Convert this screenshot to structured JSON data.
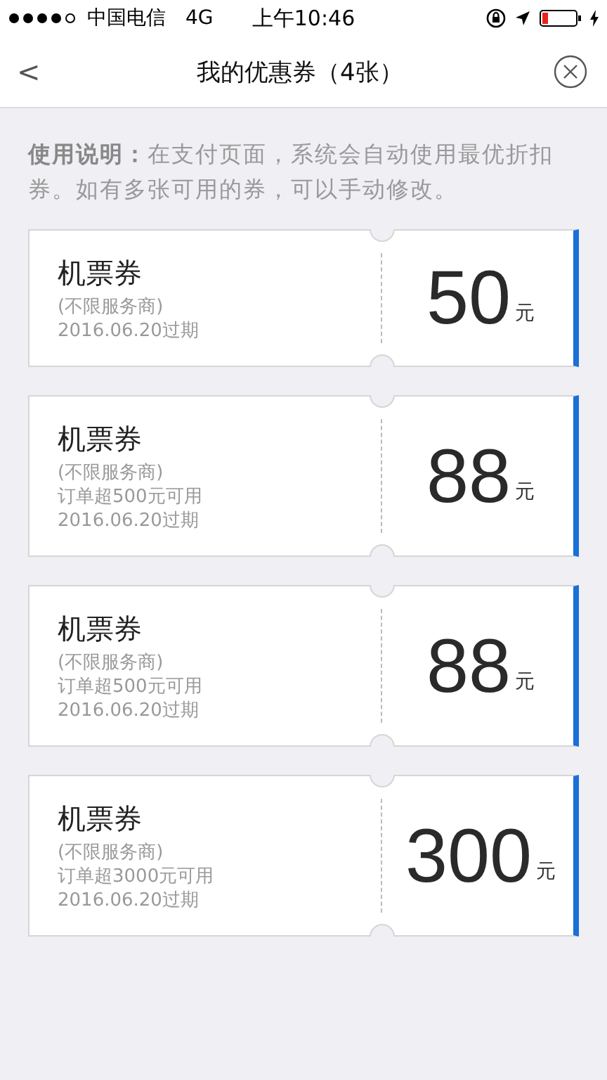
{
  "status_bar": {
    "carrier": "中国电信",
    "network": "4G",
    "time": "上午10:46"
  },
  "nav": {
    "back": "<",
    "title": "我的优惠券（4张）"
  },
  "notice": "**使用说明：**在支付页面，系统会自动使用最优折扣券。如有多张可用的券，可以手动修改。",
  "coupons": [
    {
      "name": "机票券",
      "details": [
        "(不限服务商)",
        "2016.06.20过期"
      ],
      "amount": "50",
      "unit": "元"
    },
    {
      "name": "机票券",
      "details": [
        "(不限服务商)",
        "订单超500元可用",
        "2016.06.20过期"
      ],
      "amount": "88",
      "unit": "元"
    },
    {
      "name": "机票券",
      "details": [
        "(不限服务商)",
        "订单超500元可用",
        "2016.06.20过期"
      ],
      "amount": "88",
      "unit": "元"
    },
    {
      "name": "机票券",
      "details": [
        "(不限服务商)",
        "订单超3000元可用",
        "2016.06.20过期"
      ],
      "amount": "300",
      "unit": "元"
    }
  ]
}
